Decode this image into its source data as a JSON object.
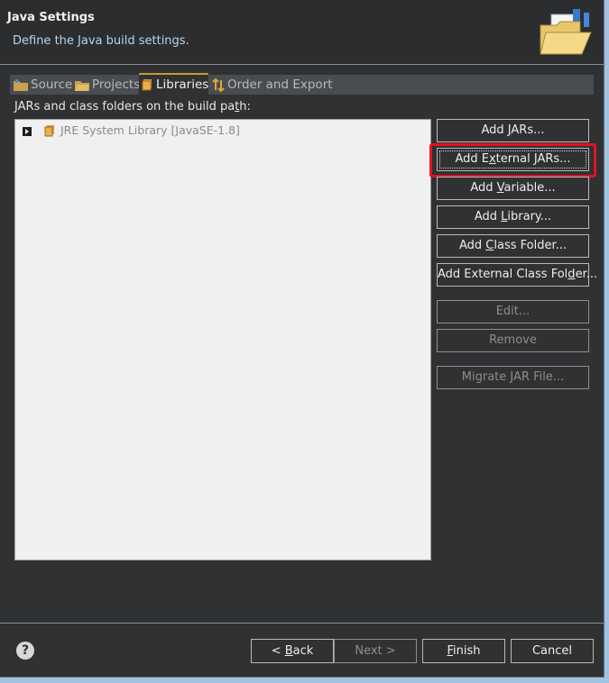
{
  "header": {
    "title": "Java Settings",
    "description": "Define the Java build settings."
  },
  "tabs": [
    {
      "label": "Source",
      "icon": "source-folder-icon",
      "active": false
    },
    {
      "label": "Projects",
      "icon": "projects-folder-icon",
      "active": false
    },
    {
      "label": "Libraries",
      "icon": "library-icon",
      "active": true
    },
    {
      "label": "Order and Export",
      "icon": "order-export-icon",
      "active": false
    }
  ],
  "libraries": {
    "label_pre": "JARs and class folders on the build pa",
    "label_u": "t",
    "label_post": "h:",
    "entries": [
      {
        "label": "JRE System Library [JavaSE-1.8]",
        "icon": "jre-library-icon"
      }
    ]
  },
  "buttons": [
    {
      "pre": "Add ",
      "u": "J",
      "post": "ARs...",
      "enabled": true
    },
    {
      "pre": "Add E",
      "u": "x",
      "post": "ternal JARs...",
      "enabled": true,
      "focused": true,
      "highlighted": true
    },
    {
      "pre": "Add ",
      "u": "V",
      "post": "ariable...",
      "enabled": true
    },
    {
      "pre": "Add ",
      "u": "L",
      "post": "ibrary...",
      "enabled": true
    },
    {
      "pre": "Add ",
      "u": "C",
      "post": "lass Folder...",
      "enabled": true
    },
    {
      "pre": "Add External Class Fol",
      "u": "d",
      "post": "er...",
      "enabled": true
    },
    {
      "pre": "Edit...",
      "u": "",
      "post": "",
      "enabled": false
    },
    {
      "pre": "Remove",
      "u": "",
      "post": "",
      "enabled": false
    },
    {
      "pre": "Migrate JAR File...",
      "u": "",
      "post": "",
      "enabled": false
    }
  ],
  "footer": {
    "help_symbol": "?",
    "back": {
      "pre": "< ",
      "u": "B",
      "post": "ack"
    },
    "next": "Next >",
    "finish": {
      "u": "F",
      "post": "inish"
    },
    "cancel": "Cancel"
  },
  "colors": {
    "background": "#2f3133",
    "highlight_border": "#e0141e",
    "active_tab_accent": "#c89b2b"
  }
}
